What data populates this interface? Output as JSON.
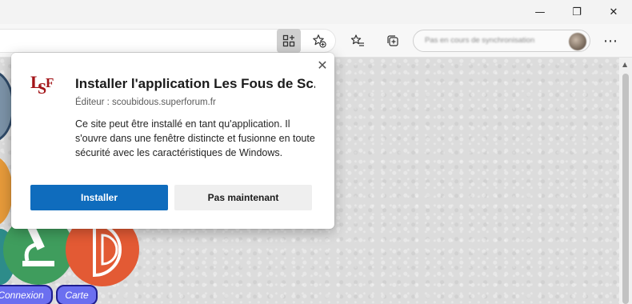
{
  "window_controls": {
    "minimize_glyph": "—",
    "maximize_glyph": "❐",
    "close_glyph": "✕"
  },
  "toolbar": {
    "sync_text": "Pas en cours de synchronisation",
    "more_glyph": "⋯"
  },
  "icons": {
    "app_available": "app-available-icon",
    "add_favorite": "add-favorite-icon",
    "favorites": "favorites-icon",
    "collections": "collections-icon",
    "settings_more": "more-options-icon"
  },
  "dialog": {
    "title": "Installer l'application Les Fous de Sc...",
    "publisher": "Éditeur : scoubidous.superforum.fr",
    "description": "Ce site peut être installé en tant qu'application. Il s'ouvre dans une fenêtre distincte et fusionne en toute sécurité avec les caractéristiques de Windows.",
    "install_label": "Installer",
    "not_now_label": "Pas maintenant",
    "close_glyph": "✕",
    "logo_letters": [
      "L",
      "S",
      "F"
    ]
  },
  "site": {
    "connexion_label": "Connexion",
    "carte_label": "Carte"
  },
  "colors": {
    "accent": "#0f6cbd",
    "logo_red": "#a31418",
    "site_button": "#6b6ff0"
  }
}
